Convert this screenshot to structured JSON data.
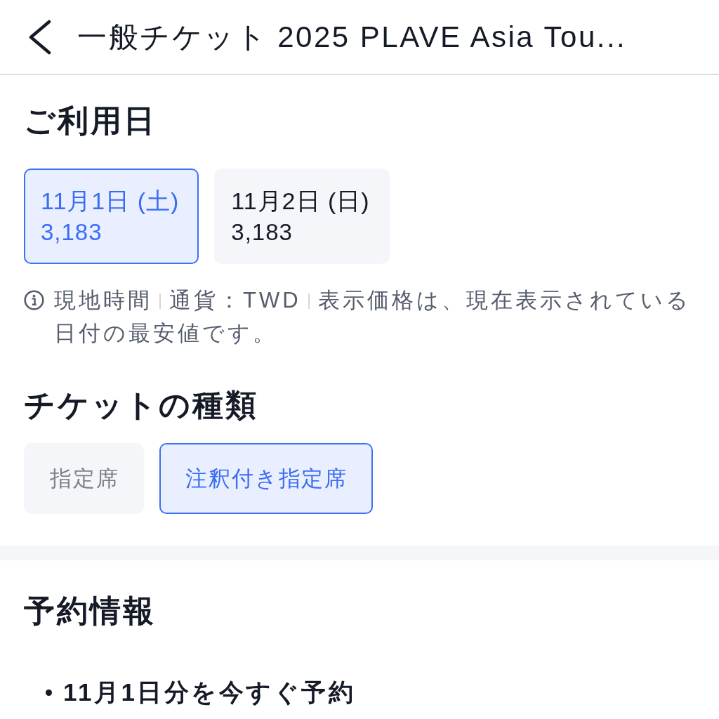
{
  "header": {
    "title": "一般チケット 2025 PLAVE Asia Tou..."
  },
  "date_section": {
    "heading": "ご利用日",
    "dates": [
      {
        "date": "11月1日 (土)",
        "price": "3,183",
        "selected": true
      },
      {
        "date": "11月2日 (日)",
        "price": "3,183",
        "selected": false
      }
    ],
    "note": [
      "現地時間",
      "通貨：TWD",
      "表示価格は、現在表示されている日付の最安値です。"
    ]
  },
  "ticket_section": {
    "heading": "チケットの種類",
    "types": [
      {
        "label": "指定席",
        "selected": false
      },
      {
        "label": "注釈付き指定席",
        "selected": true
      }
    ]
  },
  "booking_section": {
    "heading": "予約情報",
    "items": [
      "11月1日分を今すぐ予約"
    ]
  }
}
